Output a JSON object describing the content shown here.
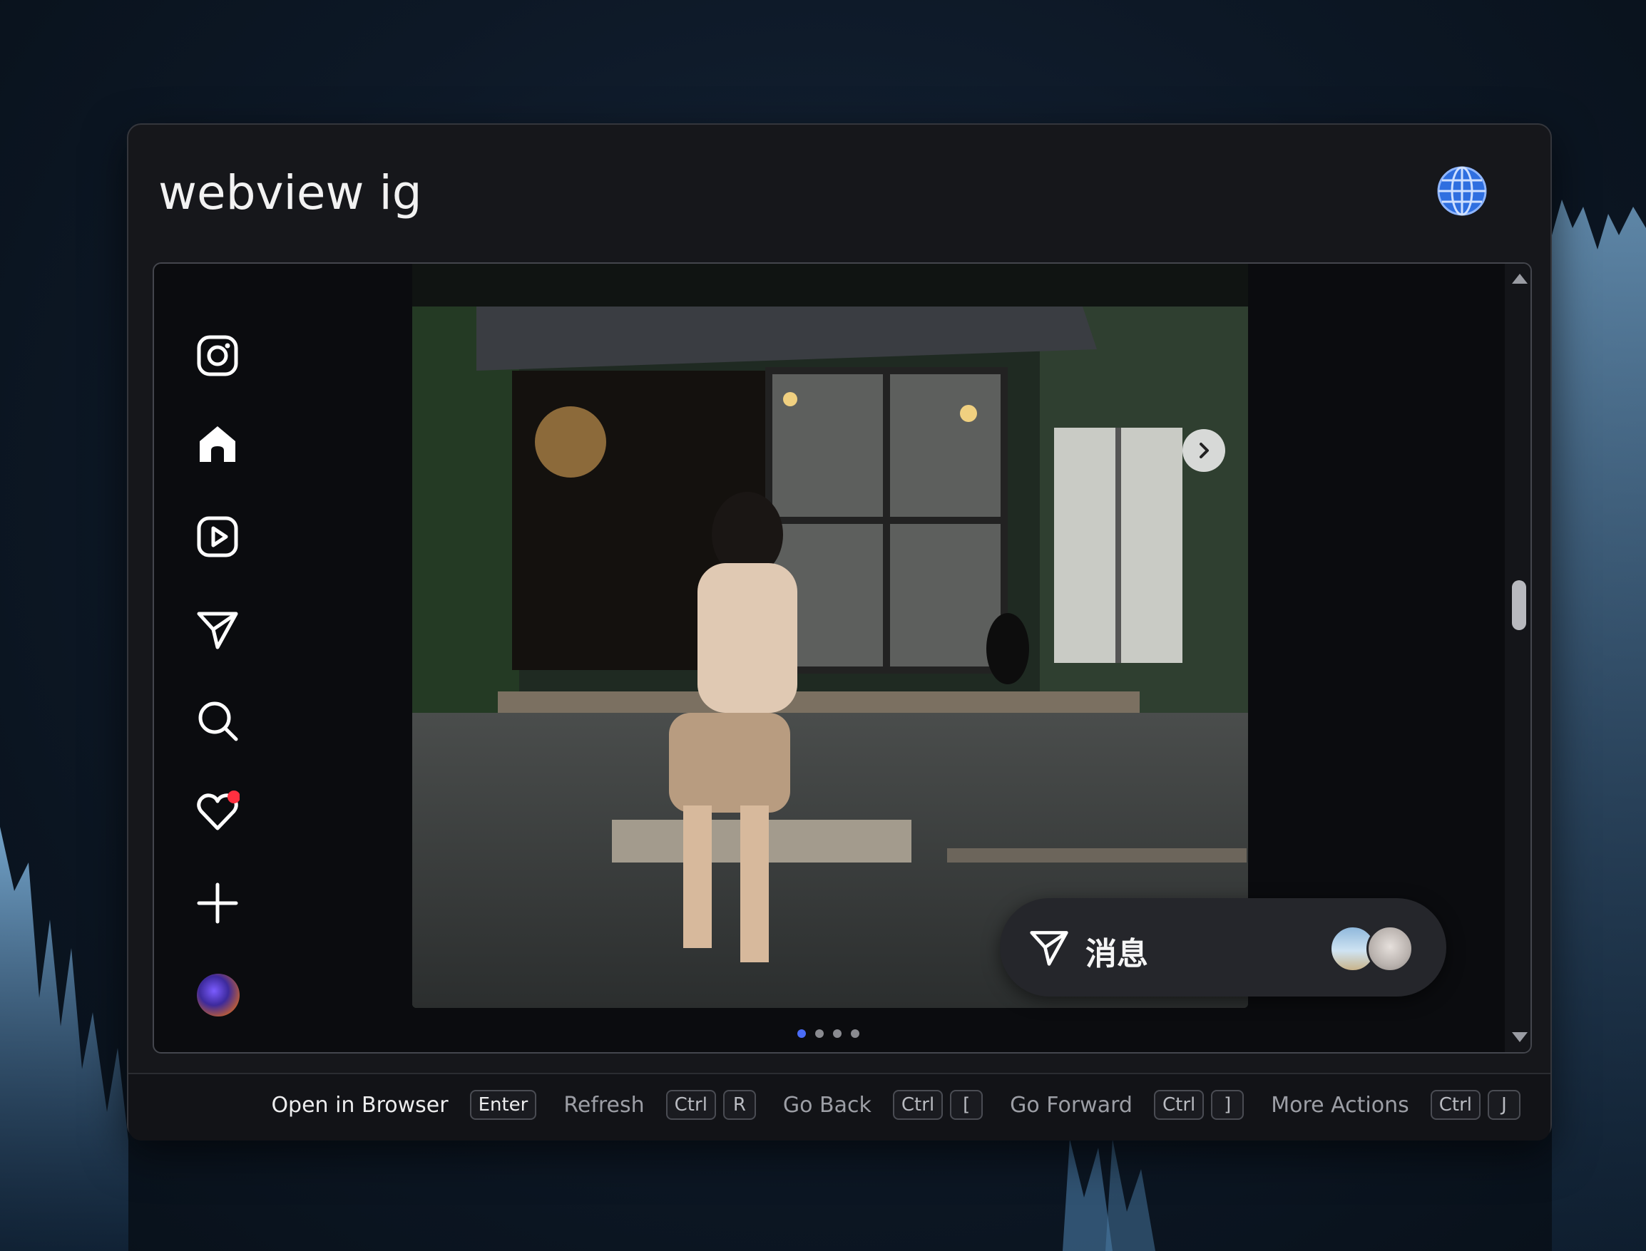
{
  "window": {
    "title": "webview ig",
    "globe_icon": "globe-icon"
  },
  "sidebar": {
    "items": [
      {
        "name": "instagram-logo-icon"
      },
      {
        "name": "home-icon"
      },
      {
        "name": "reels-icon"
      },
      {
        "name": "direct-message-icon"
      },
      {
        "name": "search-icon"
      },
      {
        "name": "notifications-heart-icon",
        "badge_color": "#ff3040"
      },
      {
        "name": "create-plus-icon"
      },
      {
        "name": "profile-avatar"
      }
    ]
  },
  "post": {
    "carousel_dots": 4,
    "active_dot": 0,
    "accent": "#4a6cf7"
  },
  "messages_pill": {
    "label": "消息"
  },
  "footer": {
    "actions": [
      {
        "label": "Open in Browser",
        "keys": [
          "Enter"
        ]
      },
      {
        "label": "Refresh",
        "keys": [
          "Ctrl",
          "R"
        ]
      },
      {
        "label": "Go Back",
        "keys": [
          "Ctrl",
          "["
        ]
      },
      {
        "label": "Go Forward",
        "keys": [
          "Ctrl",
          "]"
        ]
      },
      {
        "label": "More Actions",
        "keys": [
          "Ctrl",
          "J"
        ]
      }
    ]
  }
}
